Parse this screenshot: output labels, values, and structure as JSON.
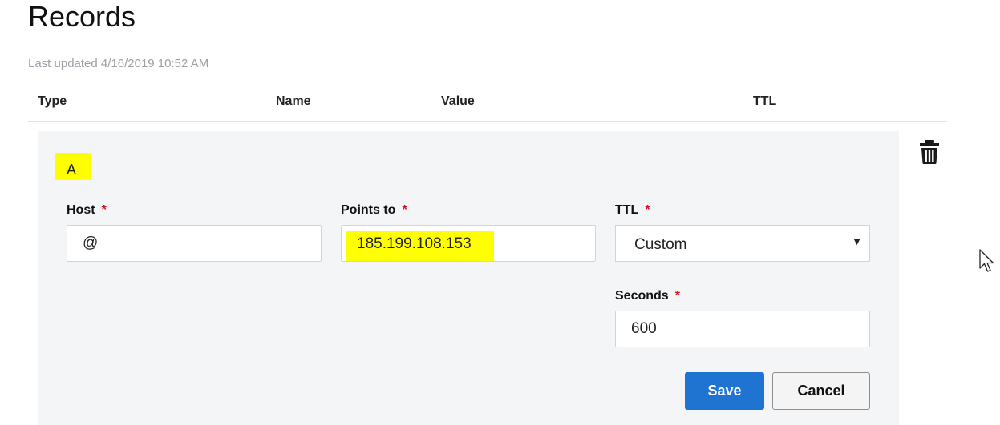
{
  "page": {
    "title": "Records",
    "last_updated": "Last updated 4/16/2019 10:52 AM"
  },
  "table": {
    "columns": [
      "Type",
      "Name",
      "Value",
      "TTL"
    ]
  },
  "record": {
    "type": "A",
    "host": {
      "label": "Host",
      "required_mark": "*",
      "value": "@"
    },
    "points_to": {
      "label": "Points to",
      "required_mark": "*",
      "value": "185.199.108.153"
    },
    "ttl": {
      "label": "TTL",
      "required_mark": "*",
      "selected": "Custom",
      "caret": "▼"
    },
    "seconds": {
      "label": "Seconds",
      "required_mark": "*",
      "value": "600"
    }
  },
  "actions": {
    "save_label": "Save",
    "cancel_label": "Cancel"
  },
  "icons": {
    "delete": "trash-icon",
    "pointer": "mouse-cursor-icon"
  },
  "colors": {
    "primary": "#1f73d1",
    "required": "#d7141e",
    "highlight": "#ffff00",
    "panel_bg": "#f4f5f6",
    "muted_text": "#9aa0a6"
  }
}
